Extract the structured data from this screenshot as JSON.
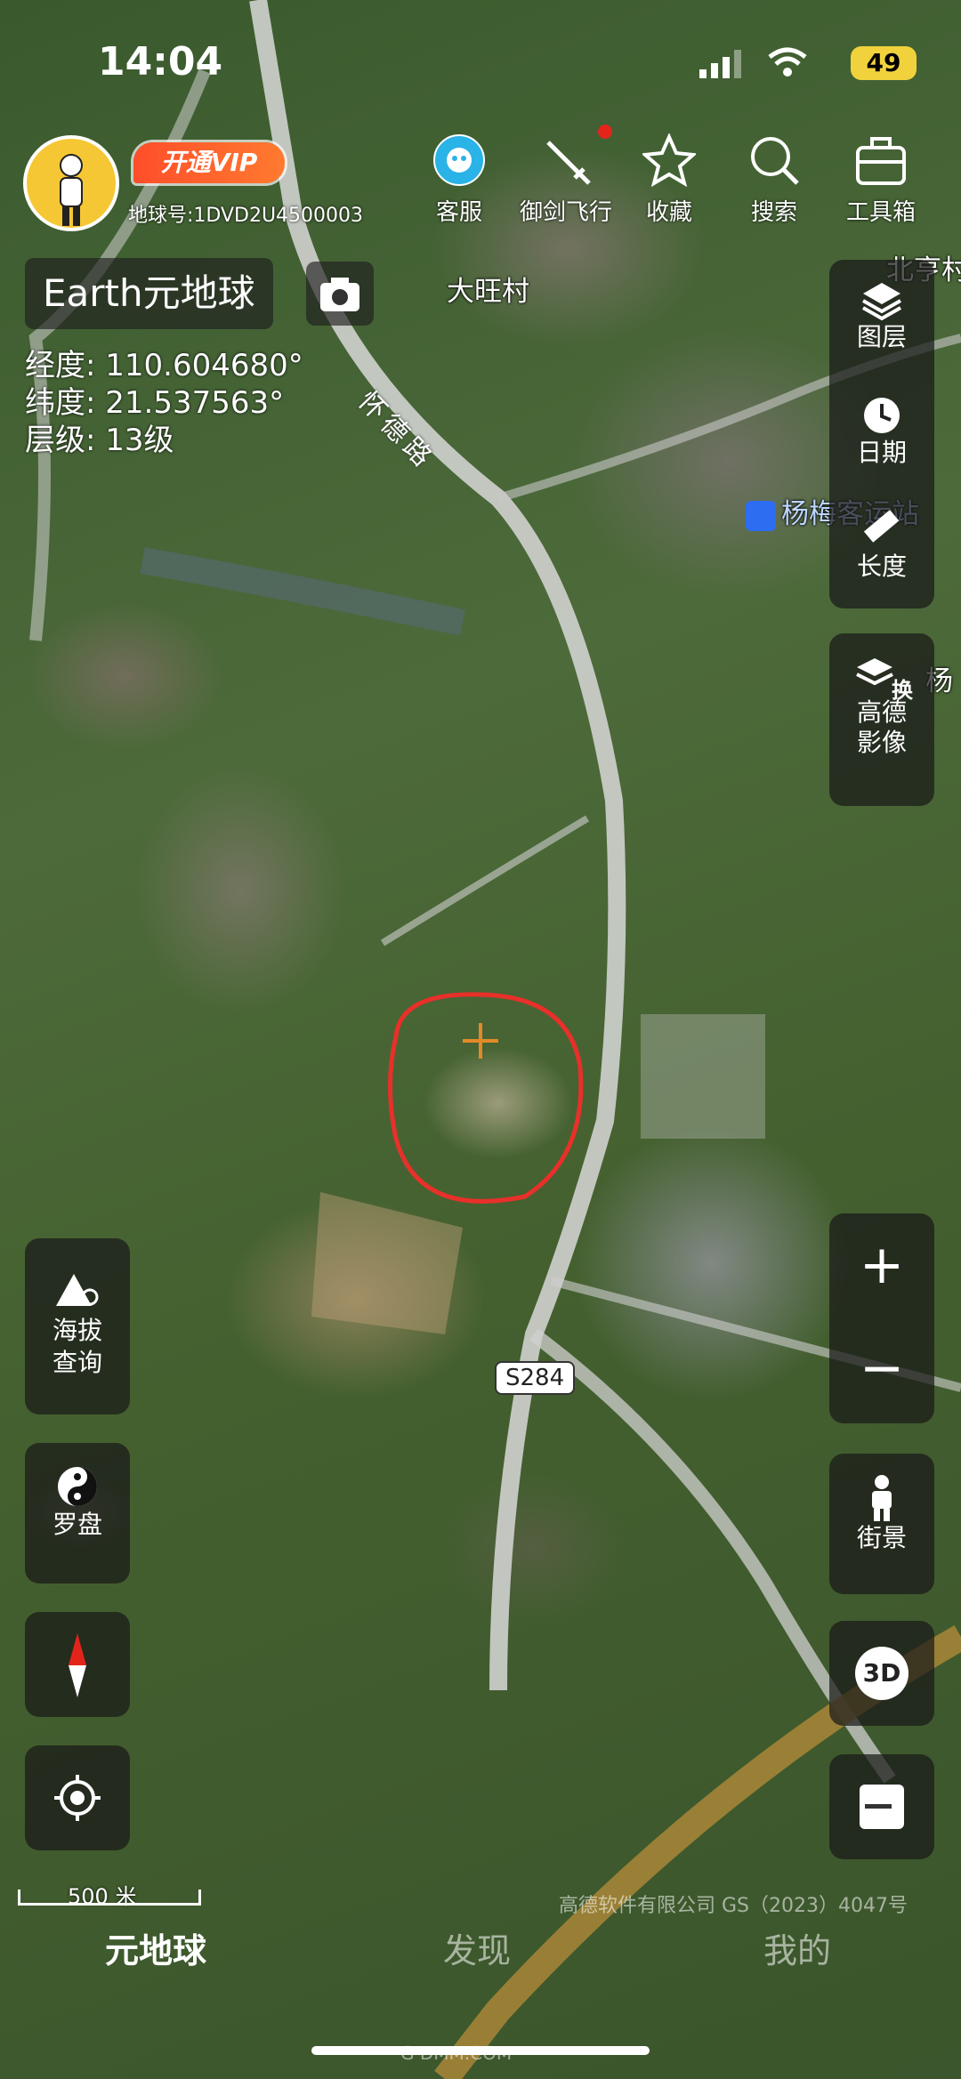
{
  "status_bar": {
    "time": "14:04",
    "battery": "49"
  },
  "header": {
    "vip_label": "开通VIP",
    "uid": "地球号:1DVD2U4500003",
    "buttons": [
      {
        "label": "客服",
        "icon": "customer-service-icon"
      },
      {
        "label": "御剑飞行",
        "icon": "sword-flight-icon"
      },
      {
        "label": "收藏",
        "icon": "star-icon"
      },
      {
        "label": "搜索",
        "icon": "search-icon"
      },
      {
        "label": "工具箱",
        "icon": "toolbox-icon"
      }
    ]
  },
  "map_title": "Earth元地球",
  "coords": {
    "lon_label": "经度:",
    "lon": "110.604680°",
    "lat_label": "纬度:",
    "lat": "21.537563°",
    "level_label": "层级:",
    "level": "13级"
  },
  "places": {
    "village1": "大旺村",
    "village2": "北亨村",
    "station": "杨梅客运站",
    "edge": "杨",
    "road": "怀德路",
    "highway": "S284"
  },
  "right_panel": {
    "layers": "图层",
    "date": "日期",
    "length": "长度",
    "imagery_line1": "高德",
    "imagery_line2": "影像",
    "imagery_badge": "换",
    "zoom_in": "+",
    "zoom_out": "−",
    "street_view": "街景",
    "three_d": "3D"
  },
  "left_panel": {
    "altitude_line1": "海拔",
    "altitude_line2": "查询",
    "compass_tool": "罗盘"
  },
  "scale_bar": "500 米",
  "copyright": "高德软件有限公司  GS（2023）4047号",
  "nav": {
    "tab1": "元地球",
    "tab2": "发现",
    "tab3": "我的"
  },
  "watermark": "G DMM.COM"
}
